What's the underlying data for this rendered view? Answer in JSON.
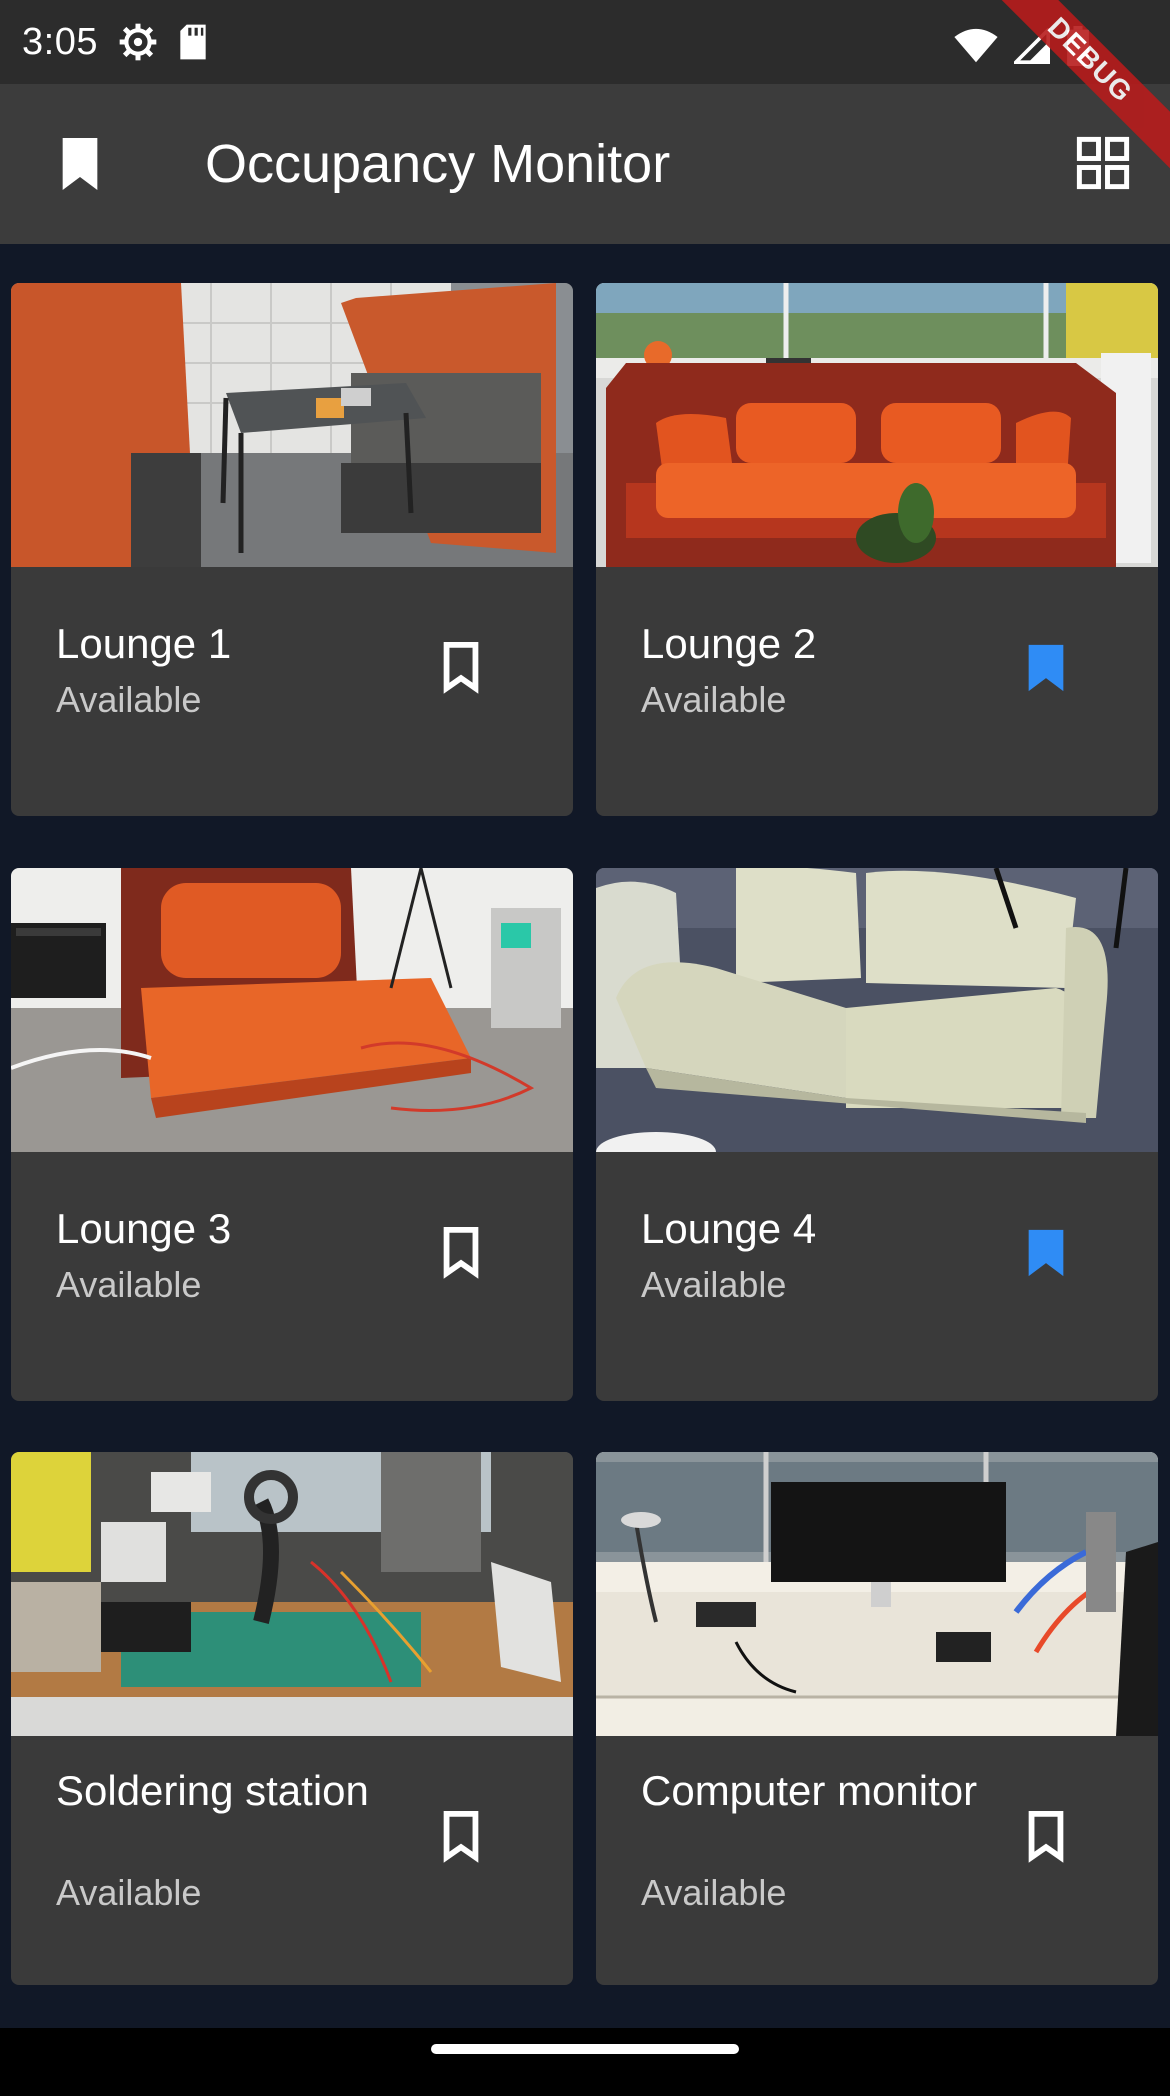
{
  "status_bar": {
    "time": "3:05",
    "icons_left": [
      "settings-icon",
      "sd-card-icon"
    ],
    "icons_right": [
      "wifi-icon",
      "signal-icon",
      "battery-icon"
    ]
  },
  "debug_banner": "DEBUG",
  "app_bar": {
    "title": "Occupancy Monitor",
    "left_icon": "bookmark-icon",
    "right_icon": "grid-view-icon"
  },
  "cards": [
    {
      "name": "Lounge 1",
      "status": "Available",
      "bookmarked": false
    },
    {
      "name": "Lounge 2",
      "status": "Available",
      "bookmarked": true
    },
    {
      "name": "Lounge 3",
      "status": "Available",
      "bookmarked": false
    },
    {
      "name": "Lounge 4",
      "status": "Available",
      "bookmarked": true
    },
    {
      "name": "Soldering station",
      "status": "Available",
      "bookmarked": false
    },
    {
      "name": "Computer monitor",
      "status": "Available",
      "bookmarked": false
    }
  ],
  "colors": {
    "bookmark_active": "#2f8cf5",
    "bookmark_inactive": "#ffffff",
    "background": "#111827",
    "card": "#3a3a3a"
  }
}
